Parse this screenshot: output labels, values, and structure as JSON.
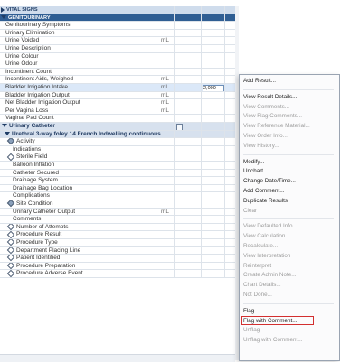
{
  "grid": {
    "header_rows": [
      "VITAL SIGNS",
      "GENITOURINARY"
    ],
    "rows": [
      {
        "label": "Genitourinary Symptoms",
        "indent": 6,
        "unit": ""
      },
      {
        "label": "Urinary Elimination",
        "indent": 6,
        "unit": ""
      },
      {
        "label": "Urine Voided",
        "indent": 6,
        "unit": "mL"
      },
      {
        "label": "Urine Description",
        "indent": 6,
        "unit": ""
      },
      {
        "label": "Urine Colour",
        "indent": 6,
        "unit": ""
      },
      {
        "label": "Urine Odour",
        "indent": 6,
        "unit": ""
      },
      {
        "label": "Incontinent Count",
        "indent": 6,
        "unit": ""
      },
      {
        "label": "Incontinent Aids, Weighed",
        "indent": 6,
        "unit": "mL"
      },
      {
        "label": "Bladder Irrigation Intake",
        "indent": 6,
        "unit": "mL",
        "selected": true,
        "value": "2,000"
      },
      {
        "label": "Bladder Irrigation Output",
        "indent": 6,
        "unit": "mL"
      },
      {
        "label": "Net Bladder Irrigation Output",
        "indent": 6,
        "unit": "mL"
      },
      {
        "label": "Per Vagina Loss",
        "indent": 6,
        "unit": "mL"
      },
      {
        "label": "Vaginal Pad Count",
        "indent": 6,
        "unit": ""
      }
    ],
    "section": "Urinary Catheter",
    "subsection": "Urethral 3-way foley 14 French Indwelling continuous...",
    "rows2": [
      {
        "label": "Activity",
        "indent": 8,
        "icon": "diamond-fill"
      },
      {
        "label": "Indications",
        "indent": 14,
        "unit": ""
      },
      {
        "label": "Sterile Field",
        "indent": 8,
        "icon": "diamond"
      },
      {
        "label": "Balloon Inflation",
        "indent": 14,
        "unit": ""
      },
      {
        "label": "Catheter Secured",
        "indent": 14,
        "unit": ""
      },
      {
        "label": "Drainage System",
        "indent": 14,
        "unit": ""
      },
      {
        "label": "Drainage Bag Location",
        "indent": 14,
        "unit": ""
      },
      {
        "label": "Complications",
        "indent": 14,
        "unit": ""
      },
      {
        "label": "Site Condition",
        "indent": 8,
        "icon": "diamond-fill"
      },
      {
        "label": "Urinary Catheter Output",
        "indent": 14,
        "unit": "mL"
      },
      {
        "label": "Comments",
        "indent": 14,
        "unit": ""
      },
      {
        "label": "Number of Attempts",
        "indent": 8,
        "icon": "diamond"
      },
      {
        "label": "Procedure Result",
        "indent": 8,
        "icon": "diamond"
      },
      {
        "label": "Procedure Type",
        "indent": 8,
        "icon": "diamond"
      },
      {
        "label": "Department Placing Line",
        "indent": 8,
        "icon": "diamond"
      },
      {
        "label": "Patient Identified",
        "indent": 8,
        "icon": "diamond"
      },
      {
        "label": "Procedure Preparation",
        "indent": 8,
        "icon": "diamond"
      },
      {
        "label": "Procedure Adverse Event",
        "indent": 8,
        "icon": "diamond"
      }
    ]
  },
  "context_menu": {
    "items": [
      {
        "label": "Add Result...",
        "enabled": true
      },
      {
        "sep": true
      },
      {
        "label": "View Result Details...",
        "enabled": true
      },
      {
        "label": "View Comments...",
        "enabled": false
      },
      {
        "label": "View Flag Comments...",
        "enabled": false
      },
      {
        "label": "View Reference Material...",
        "enabled": false
      },
      {
        "label": "View Order Info...",
        "enabled": false
      },
      {
        "label": "View History...",
        "enabled": false
      },
      {
        "sep": true
      },
      {
        "label": "Modify...",
        "enabled": true
      },
      {
        "label": "Unchart...",
        "enabled": true
      },
      {
        "label": "Change Date/Time...",
        "enabled": true
      },
      {
        "label": "Add Comment...",
        "enabled": true
      },
      {
        "label": "Duplicate Results",
        "enabled": true
      },
      {
        "label": "Clear",
        "enabled": false
      },
      {
        "sep": true
      },
      {
        "label": "View Defaulted Info...",
        "enabled": false
      },
      {
        "label": "View Calculation...",
        "enabled": false
      },
      {
        "label": "Recalculate...",
        "enabled": false
      },
      {
        "label": "View Interpretation",
        "enabled": false
      },
      {
        "label": "Reinterpret",
        "enabled": false
      },
      {
        "label": "Create Admin Note...",
        "enabled": false
      },
      {
        "label": "Chart Details...",
        "enabled": false
      },
      {
        "label": "Not Done...",
        "enabled": false
      },
      {
        "sep": true
      },
      {
        "label": "Flag",
        "enabled": true
      },
      {
        "label": "Flag with Comment...",
        "enabled": true,
        "highlighted": true
      },
      {
        "label": "Unflag",
        "enabled": false
      },
      {
        "label": "Unflag with Comment...",
        "enabled": false
      }
    ],
    "highlight_color": "#d32f2f"
  }
}
